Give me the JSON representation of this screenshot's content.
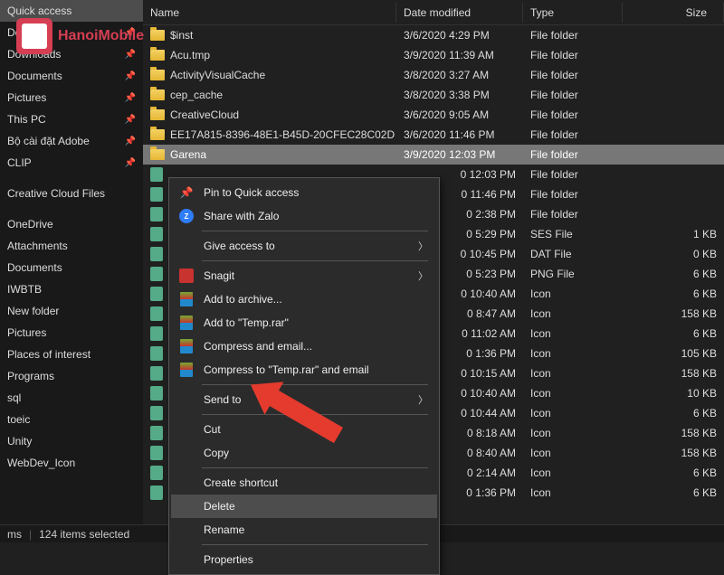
{
  "sidebar": {
    "pinned": [
      {
        "label": "Quick access"
      },
      {
        "label": "Desktop",
        "pin": true
      },
      {
        "label": "Downloads",
        "pin": true
      },
      {
        "label": "Documents",
        "pin": true
      },
      {
        "label": "Pictures",
        "pin": true
      },
      {
        "label": "This PC",
        "pin": true
      },
      {
        "label": "Bộ cài đặt Adobe",
        "pin": true
      },
      {
        "label": "CLIP",
        "pin": true
      }
    ],
    "groups": [
      {
        "label": "Creative Cloud Files"
      },
      {
        "label": "OneDrive"
      },
      {
        "label": "Attachments"
      },
      {
        "label": "Documents"
      },
      {
        "label": "IWBTB"
      },
      {
        "label": "New folder"
      },
      {
        "label": "Pictures"
      },
      {
        "label": "Places of interest"
      },
      {
        "label": "Programs"
      },
      {
        "label": "sql"
      },
      {
        "label": "toeic"
      },
      {
        "label": "Unity"
      },
      {
        "label": "WebDev_Icon"
      }
    ]
  },
  "columns": {
    "name": "Name",
    "date": "Date modified",
    "type": "Type",
    "size": "Size"
  },
  "files": [
    {
      "name": "$inst",
      "date": "3/6/2020 4:29 PM",
      "type": "File folder",
      "size": ""
    },
    {
      "name": "Acu.tmp",
      "date": "3/9/2020 11:39 AM",
      "type": "File folder",
      "size": ""
    },
    {
      "name": "ActivityVisualCache",
      "date": "3/8/2020 3:27 AM",
      "type": "File folder",
      "size": ""
    },
    {
      "name": "cep_cache",
      "date": "3/8/2020 3:38 PM",
      "type": "File folder",
      "size": ""
    },
    {
      "name": "CreativeCloud",
      "date": "3/6/2020 9:05 AM",
      "type": "File folder",
      "size": ""
    },
    {
      "name": "EE17A815-8396-48E1-B45D-20CFEC28C02D",
      "date": "3/6/2020 11:46 PM",
      "type": "File folder",
      "size": ""
    },
    {
      "name": "Garena",
      "date": "3/9/2020 12:03 PM",
      "type": "File folder",
      "size": ""
    }
  ],
  "hidden_rows": [
    {
      "date": "0 12:03 PM",
      "type": "File folder",
      "size": ""
    },
    {
      "date": "0 11:46 PM",
      "type": "File folder",
      "size": ""
    },
    {
      "date": "0 2:38 PM",
      "type": "File folder",
      "size": ""
    },
    {
      "date": "0 5:29 PM",
      "type": "SES File",
      "size": "1 KB"
    },
    {
      "date": "0 10:45 PM",
      "type": "DAT File",
      "size": "0 KB"
    },
    {
      "date": "0 5:23 PM",
      "type": "PNG File",
      "size": "6 KB"
    },
    {
      "date": "0 10:40 AM",
      "type": "Icon",
      "size": "6 KB"
    },
    {
      "date": "0 8:47 AM",
      "type": "Icon",
      "size": "158 KB"
    },
    {
      "date": "0 11:02 AM",
      "type": "Icon",
      "size": "6 KB"
    },
    {
      "date": "0 1:36 PM",
      "type": "Icon",
      "size": "105 KB"
    },
    {
      "date": "0 10:15 AM",
      "type": "Icon",
      "size": "158 KB"
    },
    {
      "date": "0 10:40 AM",
      "type": "Icon",
      "size": "10 KB"
    },
    {
      "date": "0 10:44 AM",
      "type": "Icon",
      "size": "6 KB"
    },
    {
      "date": "0 8:18 AM",
      "type": "Icon",
      "size": "158 KB"
    },
    {
      "date": "0 8:40 AM",
      "type": "Icon",
      "size": "158 KB"
    },
    {
      "date": "0 2:14 AM",
      "type": "Icon",
      "size": "6 KB"
    },
    {
      "date": "0 1:36 PM",
      "type": "Icon",
      "size": "6 KB"
    }
  ],
  "context_menu": {
    "pin": "Pin to Quick access",
    "zalo": "Share with Zalo",
    "give_access": "Give access to",
    "snagit": "Snagit",
    "add_archive": "Add to archive...",
    "add_temp": "Add to \"Temp.rar\"",
    "compress_email": "Compress and email...",
    "compress_temp_email": "Compress to \"Temp.rar\" and email",
    "send_to": "Send to",
    "cut": "Cut",
    "copy": "Copy",
    "create_shortcut": "Create shortcut",
    "delete": "Delete",
    "rename": "Rename",
    "properties": "Properties"
  },
  "statusbar": {
    "items": "ms",
    "selected": "124 items selected"
  },
  "logo_text": "HanoiMobile"
}
